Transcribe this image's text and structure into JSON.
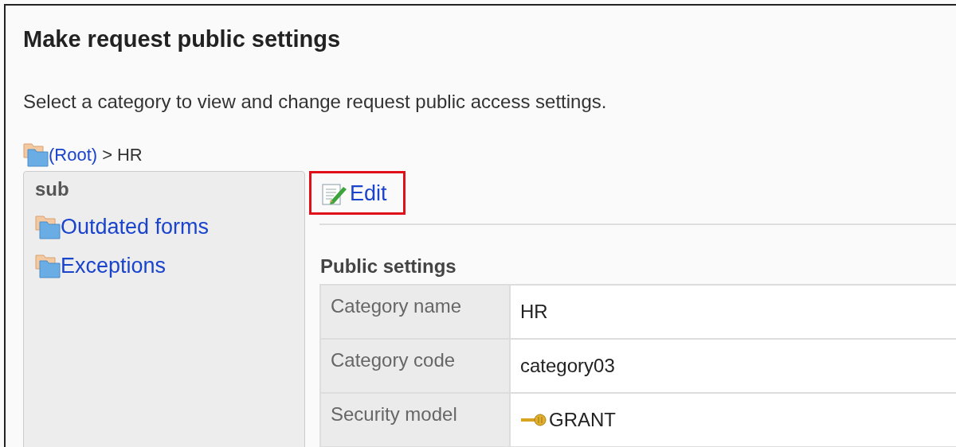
{
  "title": "Make request public settings",
  "description": "Select a category to view and change request public access settings.",
  "breadcrumb": [
    {
      "label": "(Root)",
      "kind": "link"
    },
    {
      "label": "HR",
      "kind": "current"
    }
  ],
  "breadcrumb_separator": ">",
  "sidebar": {
    "heading": "sub",
    "items": [
      {
        "label": "Outdated forms"
      },
      {
        "label": "Exceptions"
      }
    ]
  },
  "edit_link": {
    "label": "Edit",
    "highlighted": true
  },
  "section_title": "Public settings",
  "table": {
    "rows": [
      {
        "label": "Category name",
        "value": "HR",
        "kind": "text"
      },
      {
        "label": "Category code",
        "value": "category03",
        "kind": "text"
      },
      {
        "label": "Security model",
        "value": "GRANT",
        "kind": "key"
      }
    ]
  }
}
